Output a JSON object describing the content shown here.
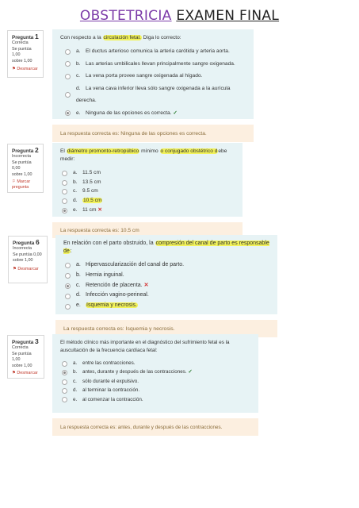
{
  "title": {
    "part1": "OBSTETRICIA",
    "part2": "EXAMEN FINAL"
  },
  "questions": [
    {
      "q_label": "Pregunta",
      "q_num": "1",
      "status": "Correcta",
      "score_line1": "Se puntúa 1,00",
      "score_line2": "sobre 1,00",
      "flag_label": "Desmarcar",
      "text_pre": "Con respecto a la ",
      "text_hl": "circulación fetal.",
      "text_post": " Diga lo correcto:",
      "options": [
        {
          "letter": "a.",
          "text": "El ductus arterioso comunica la arteria carótida y arteria aorta."
        },
        {
          "letter": "b.",
          "text": "Las arterias umbilicales llevan principalmente sangre oxigenada."
        },
        {
          "letter": "c.",
          "text": "La vena porta provee sangre oxigenada al hígado."
        },
        {
          "letter": "d.",
          "text": "La vena cava inferior lleva sólo sangre oxigenada a la aurícula derecha."
        },
        {
          "letter": "e.",
          "text": "Ninguna de las opciones es correcta.",
          "mark": "✓"
        }
      ],
      "feedback": "La respuesta correcta es: Ninguna de las opciones es correcta."
    },
    {
      "q_label": "Pregunta",
      "q_num": "2",
      "status": "Incorrecta",
      "score_line1": "Se puntúa 0,00",
      "score_line2": "sobre 1,00",
      "flag_label": "Marcar pregunta",
      "text_pre": "El ",
      "text_hl": "diámetro promonto-retropúbico",
      "text_mid": " mínimo ",
      "text_hl2": "o conjugado obstétrico d",
      "text_post": "ebe medir:",
      "options": [
        {
          "letter": "a.",
          "text": "11.5 cm"
        },
        {
          "letter": "b.",
          "text": "13.5 cm"
        },
        {
          "letter": "c.",
          "text": "9.5 cm"
        },
        {
          "letter": "d.",
          "text": "10.5 cm"
        },
        {
          "letter": "e.",
          "text": "11 cm",
          "mark": "✕"
        }
      ],
      "feedback": "La respuesta correcta es: 10.5 cm"
    },
    {
      "q_label": "Pregunta",
      "q_num": "6",
      "status": "Incorrecta",
      "score_line1": "Se puntúa 0,00",
      "score_line2": "sobre 1,00",
      "flag_label": "Desmarcar",
      "text_pre": "En relación con el parto obstruido, la ",
      "text_hl": "compresión del canal de parto es responsable de",
      "text_post": ":",
      "options": [
        {
          "letter": "a.",
          "text": "Hipervascularización del canal de parto."
        },
        {
          "letter": "b.",
          "text": "Hernia inguinal."
        },
        {
          "letter": "c.",
          "text": "Retención de placenta.",
          "mark": "✕"
        },
        {
          "letter": "d.",
          "text": "Infección vagino-perineal."
        },
        {
          "letter": "e.",
          "text": "Isquemia y necrosis."
        }
      ],
      "feedback": "La respuesta correcta es: Isquemia y necrosis."
    },
    {
      "q_label": "Pregunta",
      "q_num": "3",
      "status": "Correcta",
      "score_line1": "Se puntúa 1,00",
      "score_line2": "sobre 1,00",
      "flag_label": "Desmarcar",
      "text_pre": "El método clínico más importante en el diagnóstico del sufrimiento fetal es la auscultación de la frecuencia cardíaca fetal:",
      "options": [
        {
          "letter": "a.",
          "text": "entre las contracciones."
        },
        {
          "letter": "b.",
          "text": "antes, durante y después de las contracciones.",
          "mark": "✓"
        },
        {
          "letter": "c.",
          "text": "sólo durante el expulsivo."
        },
        {
          "letter": "d.",
          "text": "al terminar la contracción."
        },
        {
          "letter": "e.",
          "text": "al comenzar la contracción."
        }
      ],
      "feedback": "La respuesta correcta es: antes, durante y después de las contracciones."
    }
  ]
}
